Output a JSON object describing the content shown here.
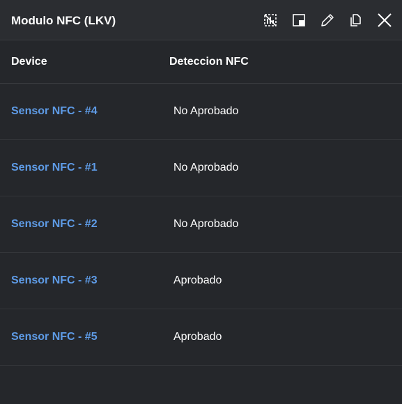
{
  "panel": {
    "title": "Modulo NFC (LKV)",
    "tools": [
      {
        "icon": "no-data-icon"
      },
      {
        "icon": "minimize-window-icon"
      },
      {
        "icon": "pencil-icon"
      },
      {
        "icon": "copy-icon"
      },
      {
        "icon": "close-icon"
      }
    ]
  },
  "table": {
    "headers": {
      "device": "Device",
      "detection": "Deteccion NFC"
    },
    "rows": [
      {
        "device": "Sensor NFC - #4",
        "status": "No Aprobado"
      },
      {
        "device": "Sensor NFC - #1",
        "status": "No Aprobado"
      },
      {
        "device": "Sensor NFC - #2",
        "status": "No Aprobado"
      },
      {
        "device": "Sensor NFC - #3",
        "status": "Aprobado"
      },
      {
        "device": "Sensor NFC - #5",
        "status": "Aprobado"
      }
    ]
  },
  "colors": {
    "background": "#25272b",
    "titlebar": "#2b2d31",
    "link": "#5e9be6",
    "text": "#ffffff"
  }
}
